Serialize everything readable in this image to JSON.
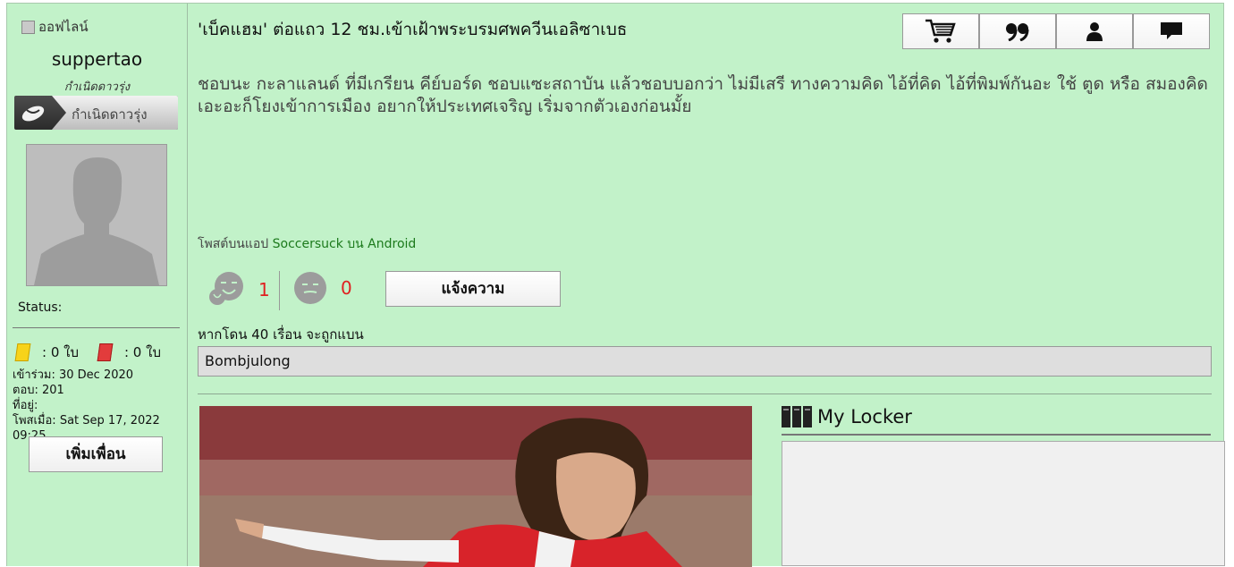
{
  "user": {
    "online_status": "ออฟไลน์",
    "username": "suppertao",
    "rank_title": "กำเนิดดาวรุ่ง",
    "rank_badge_label": "กำเนิดดาวรุ่ง",
    "status_label": "Status:",
    "yellow_cards": ": 0 ใบ",
    "red_cards": ": 0 ใบ",
    "joined": "เข้าร่วม: 30 Dec 2020",
    "replies": "ตอบ: 201",
    "location": "ที่อยู่:",
    "posted_at": "โพสเมื่อ: Sat Sep 17, 2022 09:25",
    "add_friend_label": "เพิ่มเพื่อน"
  },
  "post": {
    "title": "'เบ็คแฮม' ต่อแถว 12 ชม.เข้าเฝ้าพระบรมศพควีนเอลิซาเบธ",
    "body": "ชอบนะ กะลาแลนด์ ที่มีเกรียน คีย์บอร์ด ชอบแซะสถาบัน แล้วชอบบอกว่า ไม่มีเสรี ทางความคิด ไอ้ที่คิด ไอ้ที่พิมพ์กันอะ ใช้ ตูด หรือ สมองคิด เอะอะก็โยงเข้าการเมือง อยากให้ประเทศเจริญ เริ่มจากตัวเองก่อนมั้ย",
    "posted_via_prefix": "โพสต์บนแอป ",
    "posted_via_app": "Soccersuck บน Android",
    "likes": "1",
    "dislikes": "0",
    "report_label": "แจ้งความ",
    "ban_note": "หากโดน 40 เรื่อน จะถูกแบน",
    "signature": "Bombjulong"
  },
  "toolbar": {
    "icons": [
      "cart-icon",
      "quote-icon",
      "user-icon",
      "message-icon"
    ]
  },
  "locker": {
    "title": "My Locker"
  },
  "colors": {
    "background": "#c2f2c9",
    "vote_count": "#e02020",
    "link": "#1c7a1c"
  }
}
